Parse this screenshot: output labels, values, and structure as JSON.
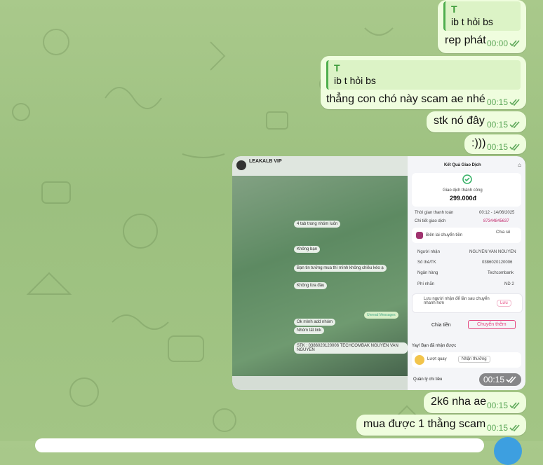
{
  "messages": [
    {
      "reply_name": "T",
      "reply_text": "ib t hỏi bs",
      "text": "rep phát",
      "time": "00:00"
    },
    {
      "reply_name": "T",
      "reply_text": "ib t hỏi bs",
      "text": "thẳng con chó này scam ae nhé",
      "time": "00:15"
    },
    {
      "text": "stk nó đây",
      "time": "00:15"
    },
    {
      "text": ":)))",
      "time": "00:15"
    },
    {
      "text": "2k6 nha ae",
      "time": "00:15"
    },
    {
      "text": "mua được 1 thằng scam",
      "time": "00:15"
    }
  ],
  "photo": {
    "time": "00:15",
    "left_screen": {
      "chat_name": "LEAKALB VIP",
      "messages": [
        "4 tab trong nhóm luôn",
        "Không bạn",
        "Bạn tin tưởng mua thì mình không chiêu kéo ạ",
        "Không lừa đâu",
        "Ok mình add nhóm",
        "Nhóm tất link"
      ],
      "payment_text": "STK : 0386020120006 TECHCOMBAK NGUYEN VAN NGUYEN",
      "unread_label": "Unread Messages"
    },
    "receipt": {
      "header": "Kết Quả Giao Dịch",
      "status": "Giao dịch thành công",
      "amount": "299.000đ",
      "time_label": "Thời gian thanh toán",
      "time_value": "00:12 - 14/06/2025",
      "code_label": "Chi tiết giao dịch",
      "code_value": "87344845637",
      "receipt_label": "Biên lai chuyển tiền",
      "share_label": "Chia sẻ",
      "recipient_label": "Người nhận",
      "recipient_value": "NGUYEN VAN NGUYEN",
      "account_label": "Số thẻ/TK",
      "account_value": "0386020120006",
      "bank_label": "Ngân hàng",
      "bank_value": "Techcombank",
      "fee_label": "Phí nhắn",
      "fee_value": "ND 2",
      "save_hint": "Lưu người nhận để lần sau chuyển nhanh hơn",
      "save_btn": "Lưu",
      "share_btn": "Chia tiền",
      "transfer_btn": "Chuyển thêm",
      "reward_title": "Yay! Bạn đã nhận được",
      "reward_item": "Lượt quay",
      "reward_btn": "Nhận thưởng",
      "manage_label": "Quản lý chi tiêu"
    }
  },
  "colors": {
    "bubble": "#effdde",
    "tick": "#5ea85a",
    "reply_bar": "#4fae4e",
    "transfer": "#e5457f"
  }
}
